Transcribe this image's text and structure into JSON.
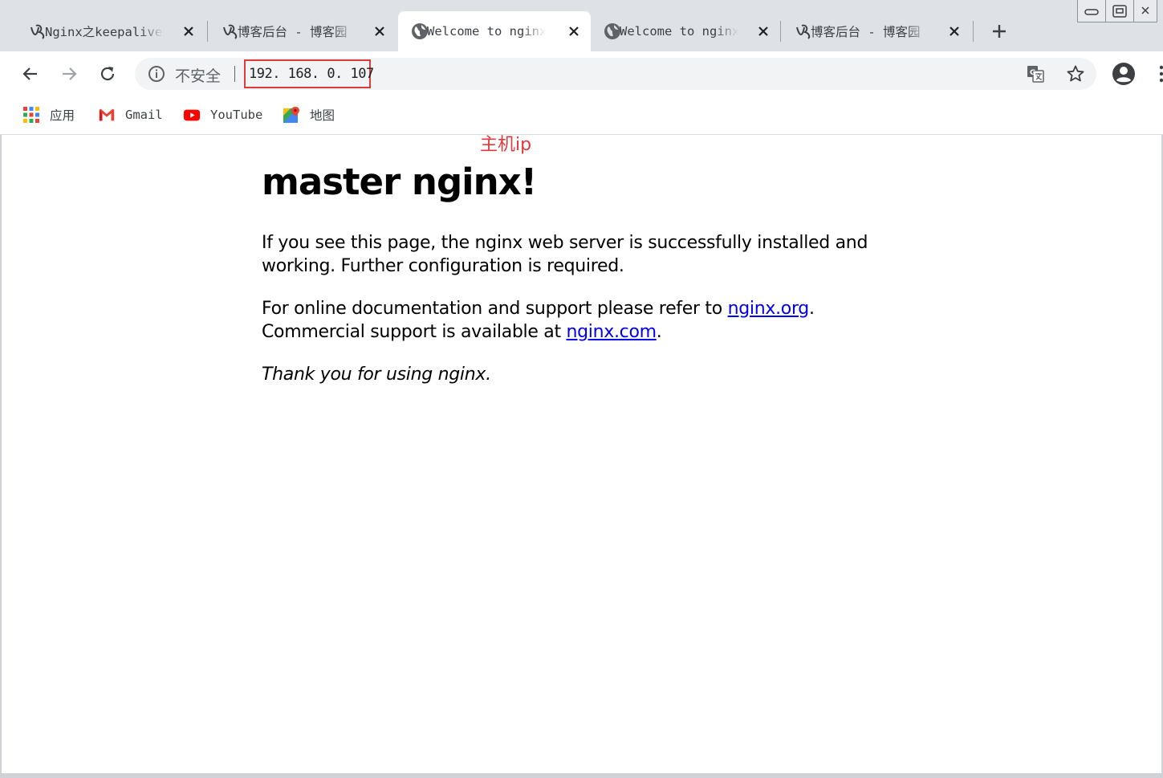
{
  "tabs": [
    {
      "title": "Nginx之keepalived",
      "favicon": "blog-logo-icon",
      "active": false
    },
    {
      "title": "博客后台 - 博客园",
      "favicon": "blog-logo-icon",
      "active": false
    },
    {
      "title": "Welcome to nginx!",
      "favicon": "globe-icon",
      "active": true
    },
    {
      "title": "Welcome to nginx!",
      "favicon": "globe-icon",
      "active": false
    },
    {
      "title": "博客后台 - 博客园",
      "favicon": "blog-logo-icon",
      "active": false
    }
  ],
  "toolbar": {
    "security_label": "不安全",
    "url": "192. 168. 0. 107"
  },
  "bookmarks": [
    {
      "label": "应用",
      "icon": "apps-grid-icon"
    },
    {
      "label": "Gmail",
      "icon": "gmail-icon"
    },
    {
      "label": "YouTube",
      "icon": "youtube-icon"
    },
    {
      "label": "地图",
      "icon": "maps-icon"
    }
  ],
  "annotation": {
    "text": "主机ip",
    "color": "#e5383b"
  },
  "page": {
    "heading": "master nginx!",
    "para1": "If you see this page, the nginx web server is successfully installed and working. Further configuration is required.",
    "para2_prefix": "For online documentation and support please refer to ",
    "link_org": "nginx.org",
    "para2_mid": ".",
    "para2_line2": "Commercial support is available at ",
    "link_com": "nginx.com",
    "para2_end": ".",
    "thanks": "Thank you for using nginx."
  },
  "colors": {
    "link": "#0000ee",
    "highlight_box": "#e03b3b",
    "tabstrip": "#dee1e6"
  }
}
